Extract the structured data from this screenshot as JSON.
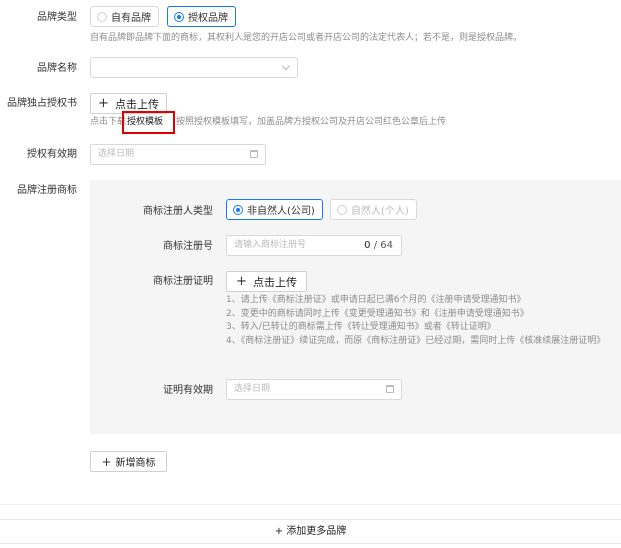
{
  "brand_type": {
    "label": "品牌类型",
    "options": [
      "自有品牌",
      "授权品牌"
    ],
    "selected": "授权品牌",
    "hint": "自有品牌即品牌下面的商标，其权利人是您的开店公司或者开店公司的法定代表人；若不是，则是授权品牌。"
  },
  "brand_name": {
    "label": "品牌名称",
    "value": ""
  },
  "exclusive_license": {
    "label": "品牌独占授权书",
    "upload_label": "点击上传",
    "hint_prefix": "点击下载",
    "template_link": "授权模板",
    "hint_suffix": "按照授权模板填写，加盖品牌方授权公司及开店公司红色公章后上传"
  },
  "license_validity": {
    "label": "授权有效期",
    "placeholder": "选择日期"
  },
  "trademark": {
    "label": "品牌注册商标",
    "registrant_type_label": "商标注册人类型",
    "registrant_options": [
      "非自然人(公司)",
      "自然人(个人)"
    ],
    "registrant_selected": "非自然人(公司)",
    "reg_number_label": "商标注册号",
    "reg_number_placeholder": "请输入商标注册号",
    "reg_number_count": "0",
    "reg_number_max": "/ 64",
    "certificate_label": "商标注册证明",
    "certificate_upload_label": "点击上传",
    "notes": [
      "1、请上传《商标注册证》或申请日起已满6个月的《注册申请受理通知书》",
      "2、变更中的商标请同时上传《变更受理通知书》和《注册申请受理通知书》",
      "3、转入/已转让的商标需上传《转让受理通知书》或者《转让证明》",
      "4、《商标注册证》续证完成，而原《商标注册证》已经过期，需同时上传《核准续展注册证明》"
    ],
    "cert_validity_label": "证明有效期",
    "cert_validity_placeholder": "选择日期"
  },
  "add_trademark_label": "新增商标",
  "add_more_brands_label": "+ 添加更多品牌",
  "colors": {
    "accent": "#1677ff",
    "highlight_box": "#e00000",
    "panel_bg": "#f5f5f5"
  }
}
